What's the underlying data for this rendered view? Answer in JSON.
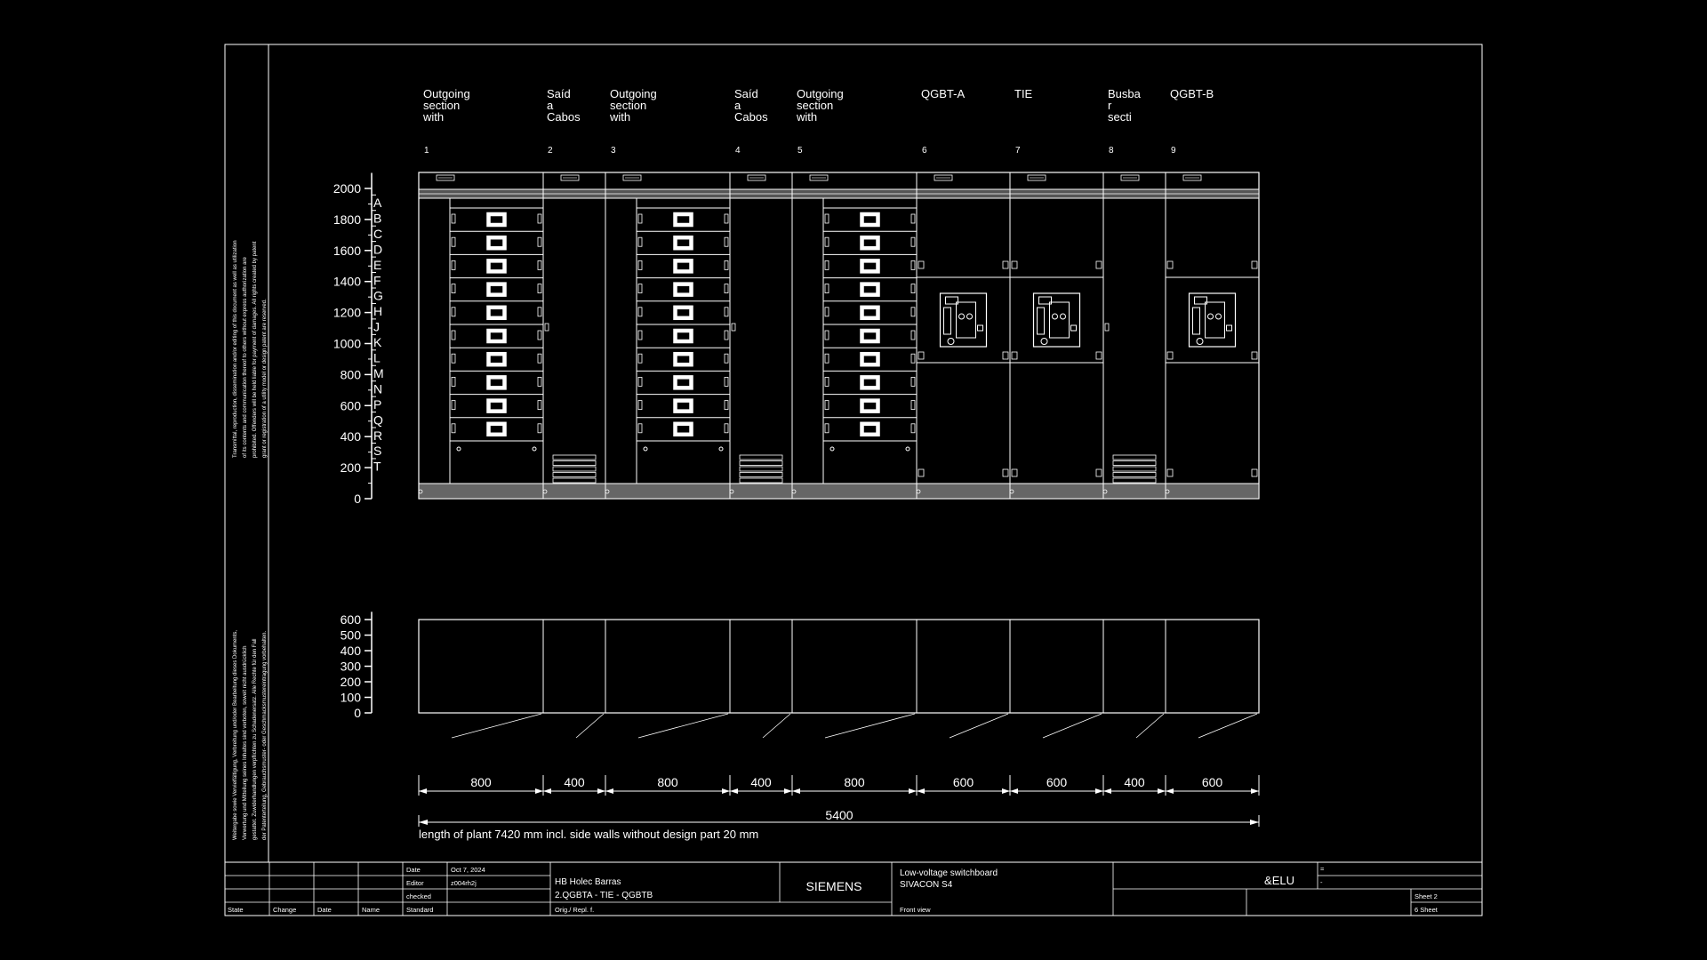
{
  "sections": [
    {
      "num": "1",
      "title": [
        "Outgoing",
        "section",
        "with"
      ],
      "width": "800",
      "kind": "drawer"
    },
    {
      "num": "2",
      "title": [
        "Saíd",
        "a",
        "Cabos"
      ],
      "width": "400",
      "kind": "cable"
    },
    {
      "num": "3",
      "title": [
        "Outgoing",
        "section",
        "with"
      ],
      "width": "800",
      "kind": "drawer"
    },
    {
      "num": "4",
      "title": [
        "Saíd",
        "a",
        "Cabos"
      ],
      "width": "400",
      "kind": "cable"
    },
    {
      "num": "5",
      "title": [
        "Outgoing",
        "section",
        "with"
      ],
      "width": "800",
      "kind": "drawer"
    },
    {
      "num": "6",
      "title": [
        "QGBT-A"
      ],
      "width": "600",
      "kind": "breaker"
    },
    {
      "num": "7",
      "title": [
        "TIE"
      ],
      "width": "600",
      "kind": "breaker"
    },
    {
      "num": "8",
      "title": [
        "Busba",
        "r",
        "secti"
      ],
      "width": "400",
      "kind": "busbar"
    },
    {
      "num": "9",
      "title": [
        "QGBT-B"
      ],
      "width": "600",
      "kind": "breaker"
    }
  ],
  "front_height_axis": [
    "2000",
    "1800",
    "1600",
    "1400",
    "1200",
    "1000",
    "800",
    "600",
    "400",
    "200",
    "0"
  ],
  "row_letters": [
    "A",
    "B",
    "C",
    "D",
    "E",
    "F",
    "G",
    "H",
    "J",
    "K",
    "L",
    "M",
    "N",
    "P",
    "Q",
    "R",
    "S",
    "T"
  ],
  "depth_axis": [
    "600",
    "500",
    "400",
    "300",
    "200",
    "100",
    "0"
  ],
  "total_length": "5400",
  "plant_note": "length of plant 7420 mm incl. side walls without design part 20 mm",
  "legal_text_top": [
    "Transmittal, reproduction, dissemination and/or editing of this document as well as utilization",
    "of its contents and communication thereof to others without express authorization are",
    "prohibited. Offenders will be held liable for payment of damages. All rights created by patent",
    "grant or registration of a utility model or design patent are reserved."
  ],
  "legal_text_bottom": [
    "Weitergabe sowie Vervielfältigung, Verbreitung und/oder Bearbeitung dieses Dokuments,",
    "Verwertung und Mitteilung seines Inhaltes sind verboten, soweit nicht ausdrücklich",
    "gestattet. Zuwiderhandlungen verpflichten zu Schadenersatz. Alle Rechte für den Fall",
    "der Patenterteilung, Gebrauchsmuster- oder Geschmacksmustereintragung vorbehalten."
  ],
  "title_block": {
    "state": "State",
    "change": "Change",
    "date_col": "Date",
    "name": "Name",
    "date_label": "Date",
    "date_value": "Oct 7, 2024",
    "editor_label": "Editor",
    "editor_value": "z004rh2j",
    "checked_label": "checked",
    "standard_label": "Standard",
    "project_line1": "HB Holec Barras",
    "project_line2": "2.QGBTA - TIE - QGBTB",
    "orig": "Orig./ Repl. f.",
    "brand": "SIEMENS",
    "product_line1": "Low-voltage switchboard",
    "product_line2": "SIVACON S4",
    "view": "Front view",
    "code": "&ELU",
    "eq1": "=",
    "eq2": "-",
    "sheet": "Sheet 2",
    "sheets": "6 Sheet"
  }
}
